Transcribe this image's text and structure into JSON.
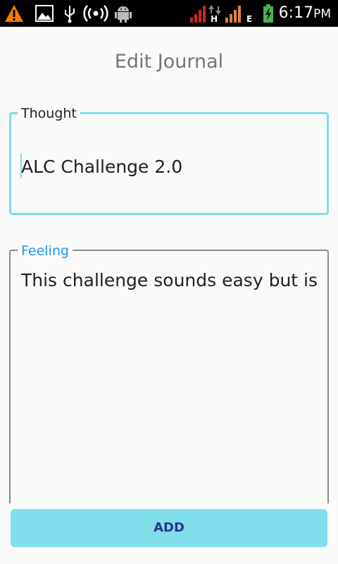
{
  "status_bar": {
    "time": "6:17",
    "ampm": "PM",
    "icons": [
      "warning-icon",
      "image-icon",
      "usb-icon",
      "hotspot-icon",
      "android-debug-icon",
      "signal-icon",
      "data-h-icon",
      "signal-icon",
      "data-e-icon",
      "battery-charging-icon"
    ],
    "network_labels": {
      "h": "H",
      "e": "E"
    }
  },
  "screen": {
    "title": "Edit Journal"
  },
  "thought": {
    "label": "Thought",
    "value": "ALC Challenge 2.0"
  },
  "feeling": {
    "label": "Feeling",
    "value": "This challenge sounds easy but is m"
  },
  "actions": {
    "add_label": "ADD"
  },
  "colors": {
    "accent": "#80deea",
    "focus_label": "#2196f3",
    "button_text": "#283593"
  }
}
